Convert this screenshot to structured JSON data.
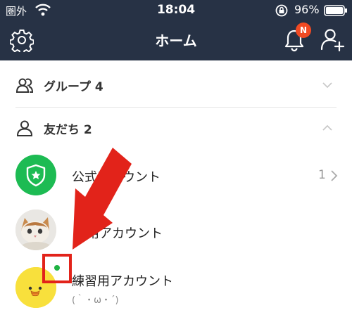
{
  "status_bar": {
    "carrier": "圏外",
    "time": "18:04",
    "battery": "96%"
  },
  "nav": {
    "title": "ホーム",
    "notification_badge": "N"
  },
  "sections": {
    "groups": {
      "label": "グループ 4",
      "expanded": false
    },
    "friends": {
      "label": "友だち 2",
      "expanded": true
    }
  },
  "rows": [
    {
      "name": "公式アカウント",
      "count": "1",
      "avatar": "official-account-shield"
    },
    {
      "name": "用アカウント",
      "avatar": "kitten-photo"
    },
    {
      "name": "練習用アカウント",
      "status_message": "(｀・ω・´)",
      "avatar": "yellow-chick",
      "online": true
    }
  ],
  "colors": {
    "header": "#273245",
    "official_green": "#1dbb53",
    "badge": "#f14a23",
    "annotation_red": "#e2231a",
    "online_dot": "#1fb343"
  }
}
